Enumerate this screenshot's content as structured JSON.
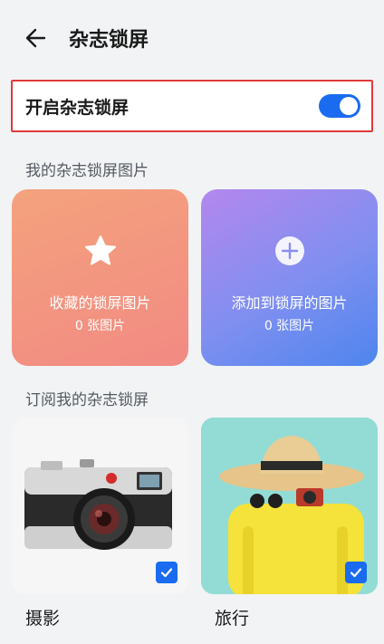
{
  "header": {
    "title": "杂志锁屏"
  },
  "toggle": {
    "label": "开启杂志锁屏",
    "state": "on"
  },
  "my_section": {
    "title": "我的杂志锁屏图片",
    "cards": [
      {
        "label": "收藏的锁屏图片",
        "count": "0 张图片",
        "icon": "star-icon"
      },
      {
        "label": "添加到锁屏的图片",
        "count": "0 张图片",
        "icon": "plus-icon"
      }
    ]
  },
  "subscribe_section": {
    "title": "订阅我的杂志锁屏",
    "items": [
      {
        "name": "摄影",
        "checked": true
      },
      {
        "name": "旅行",
        "checked": true
      }
    ]
  },
  "colors": {
    "accent": "#1a6bf0",
    "highlight_border": "#e23a3a"
  }
}
